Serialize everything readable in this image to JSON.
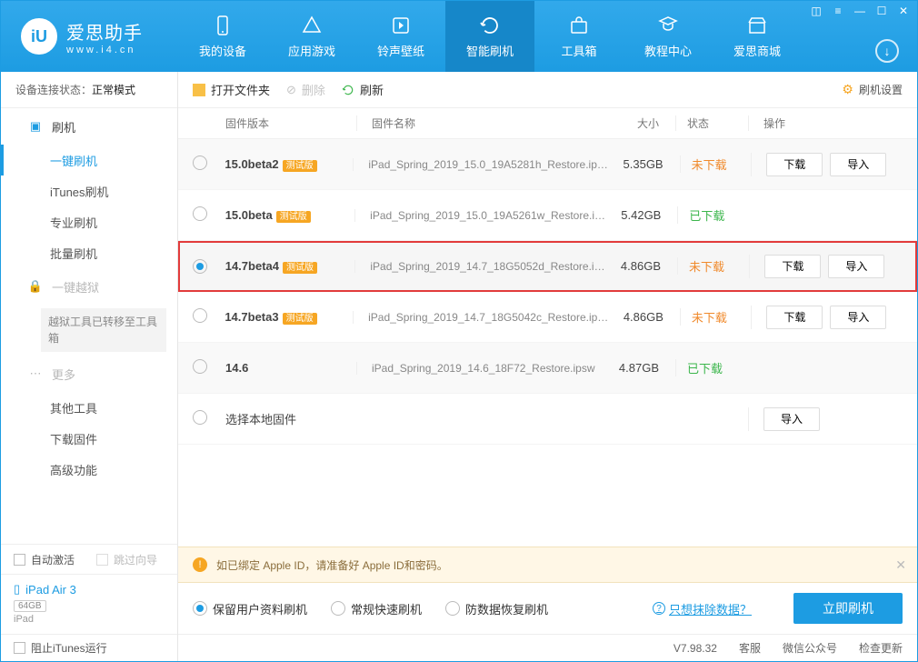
{
  "brand": {
    "title": "爱思助手",
    "url": "www.i4.cn"
  },
  "nav": {
    "items": [
      {
        "label": "我的设备"
      },
      {
        "label": "应用游戏"
      },
      {
        "label": "铃声壁纸"
      },
      {
        "label": "智能刷机"
      },
      {
        "label": "工具箱"
      },
      {
        "label": "教程中心"
      },
      {
        "label": "爱思商城"
      }
    ]
  },
  "sidebar": {
    "status_prefix": "设备连接状态：",
    "status_value": "正常模式",
    "group_flash": "刷机",
    "items_flash": [
      "一键刷机",
      "iTunes刷机",
      "专业刷机",
      "批量刷机"
    ],
    "group_jailbreak": "一键越狱",
    "jailbreak_note": "越狱工具已转移至工具箱",
    "group_more": "更多",
    "items_more": [
      "其他工具",
      "下载固件",
      "高级功能"
    ],
    "auto_activate": "自动激活",
    "skip_guide": "跳过向导",
    "device_name": "iPad Air 3",
    "device_storage": "64GB",
    "device_model": "iPad",
    "block_itunes": "阻止iTunes运行"
  },
  "toolbar": {
    "open_folder": "打开文件夹",
    "delete": "删除",
    "refresh": "刷新",
    "settings": "刷机设置"
  },
  "table": {
    "headers": {
      "version": "固件版本",
      "name": "固件名称",
      "size": "大小",
      "status": "状态",
      "action": "操作"
    },
    "download_btn": "下载",
    "import_btn": "导入",
    "select_local": "选择本地固件",
    "rows": [
      {
        "ver": "15.0beta2",
        "beta": "测试版",
        "name": "iPad_Spring_2019_15.0_19A5281h_Restore.ip…",
        "size": "5.35GB",
        "status": "未下载",
        "downloaded": false,
        "selected": false,
        "hl": false,
        "actions": true
      },
      {
        "ver": "15.0beta",
        "beta": "测试版",
        "name": "iPad_Spring_2019_15.0_19A5261w_Restore.i…",
        "size": "5.42GB",
        "status": "已下载",
        "downloaded": true,
        "selected": false,
        "hl": false,
        "actions": false
      },
      {
        "ver": "14.7beta4",
        "beta": "测试版",
        "name": "iPad_Spring_2019_14.7_18G5052d_Restore.i…",
        "size": "4.86GB",
        "status": "未下载",
        "downloaded": false,
        "selected": true,
        "hl": true,
        "actions": true
      },
      {
        "ver": "14.7beta3",
        "beta": "测试版",
        "name": "iPad_Spring_2019_14.7_18G5042c_Restore.ip…",
        "size": "4.86GB",
        "status": "未下载",
        "downloaded": false,
        "selected": false,
        "hl": false,
        "actions": true
      },
      {
        "ver": "14.6",
        "beta": "",
        "name": "iPad_Spring_2019_14.6_18F72_Restore.ipsw",
        "size": "4.87GB",
        "status": "已下载",
        "downloaded": true,
        "selected": false,
        "hl": false,
        "actions": false
      }
    ]
  },
  "alert": "如已绑定 Apple ID，请准备好 Apple ID和密码。",
  "options": {
    "keep_data": "保留用户资料刷机",
    "normal": "常规快速刷机",
    "antiloss": "防数据恢复刷机",
    "erase_link": "只想抹除数据？",
    "flash_now": "立即刷机"
  },
  "statusbar": {
    "version": "V7.98.32",
    "service": "客服",
    "wechat": "微信公众号",
    "update": "检查更新"
  }
}
